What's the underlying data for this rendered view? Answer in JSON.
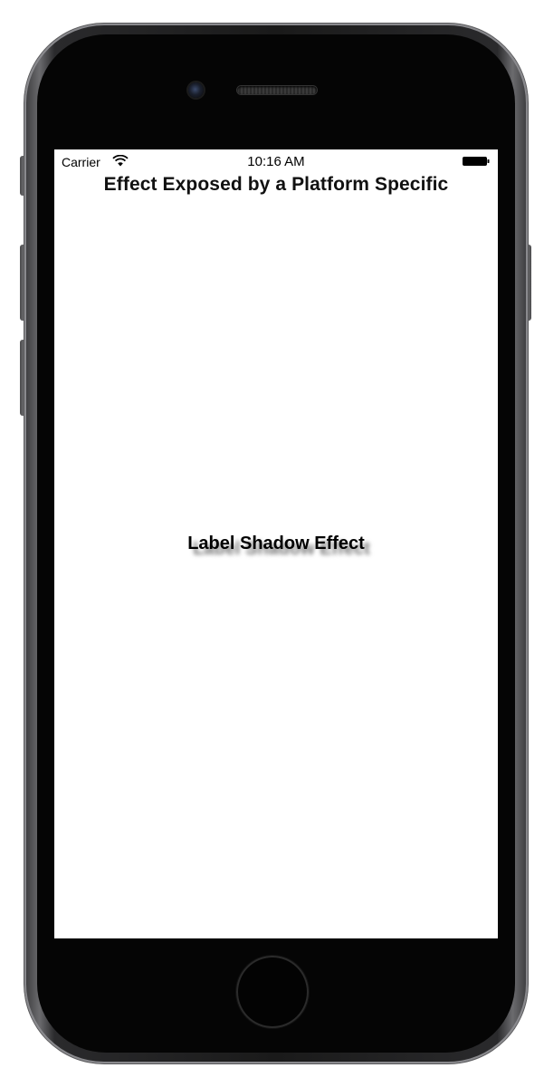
{
  "status_bar": {
    "carrier": "Carrier",
    "time": "10:16 AM",
    "wifi_icon": "wifi-icon",
    "battery_icon": "battery-icon"
  },
  "nav": {
    "title": "Effect Exposed by a Platform Specific"
  },
  "content": {
    "label": "Label Shadow Effect"
  },
  "device": {
    "home_icon": "home-button"
  }
}
